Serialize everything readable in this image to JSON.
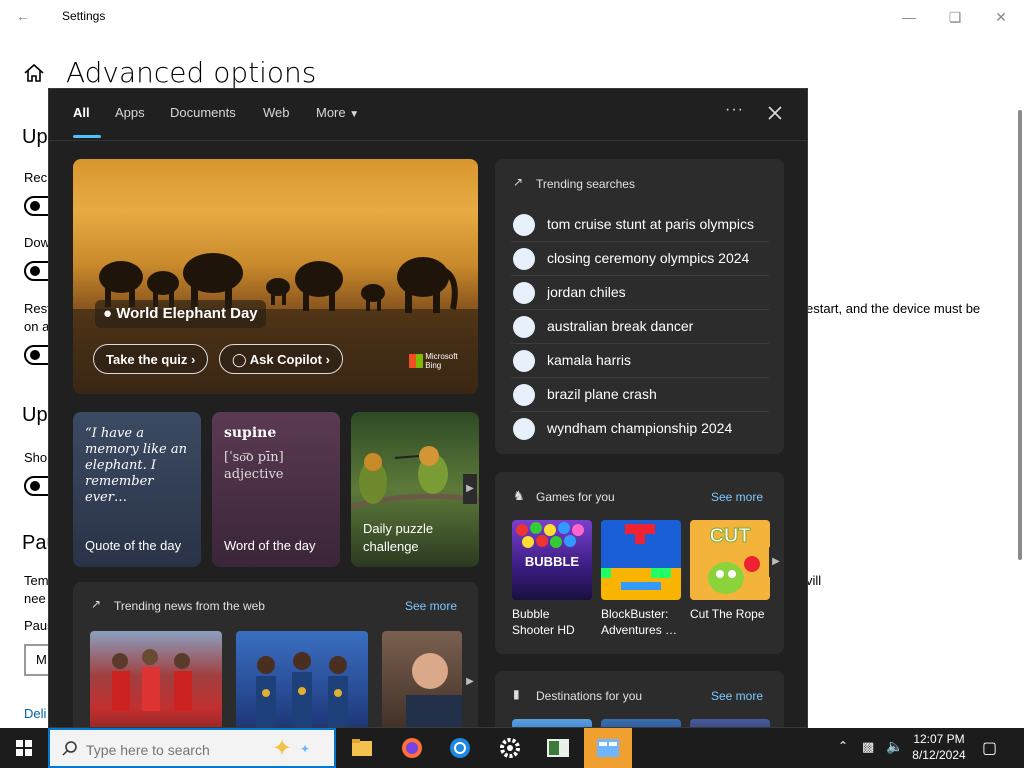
{
  "window": {
    "title": "Settings"
  },
  "settings": {
    "page_title": "Advanced options",
    "heading_1": "Up",
    "row_1": "Rec",
    "row_2": "Dow",
    "row_3a": "Rest",
    "row_3b": "on a",
    "row_3_right": "estart, and the device must be",
    "heading_2": "Up",
    "row_4": "Sho",
    "heading_3": "Pau",
    "row_5a": "Tem",
    "row_5b": "nee",
    "row_5_right": "vill",
    "row_6": "Paus",
    "select_value": "M",
    "link": "Deli"
  },
  "search": {
    "tabs": [
      {
        "label": "All",
        "active": true
      },
      {
        "label": "Apps"
      },
      {
        "label": "Documents"
      },
      {
        "label": "Web"
      },
      {
        "label": "More"
      }
    ],
    "hero": {
      "location": "World Elephant Day",
      "quiz_button": "Take the quiz",
      "copilot_button": "Ask Copilot",
      "brand_line1": "Microsoft",
      "brand_line2": "Bing"
    },
    "quote_card": {
      "quote": "“I have a memory like an elephant. I remember ever…",
      "label": "Quote of the day"
    },
    "word_card": {
      "word": "supine",
      "pronunciation": "[ˈso͞o pīn]",
      "part_of_speech": "adjective",
      "label": "Word of the day"
    },
    "puzzle_card": {
      "label": "Daily puzzle challenge"
    },
    "trending": {
      "title": "Trending searches",
      "items": [
        "tom cruise stunt at paris olympics",
        "closing ceremony olympics 2024",
        "jordan chiles",
        "australian break dancer",
        "kamala harris",
        "brazil plane crash",
        "wyndham championship 2024"
      ]
    },
    "games": {
      "title": "Games for you",
      "see_more": "See more",
      "items": [
        {
          "title": "Bubble Shooter HD",
          "art": "BUBBLE"
        },
        {
          "title": "BlockBuster: Adventures …"
        },
        {
          "title": "Cut The Rope",
          "art": "CUT"
        }
      ]
    },
    "destinations": {
      "title": "Destinations for you",
      "see_more": "See more"
    },
    "news": {
      "title": "Trending news from the web",
      "see_more": "See more"
    }
  },
  "taskbar": {
    "search_placeholder": "Type here to search",
    "time": "12:07 PM",
    "date": "8/12/2024"
  }
}
